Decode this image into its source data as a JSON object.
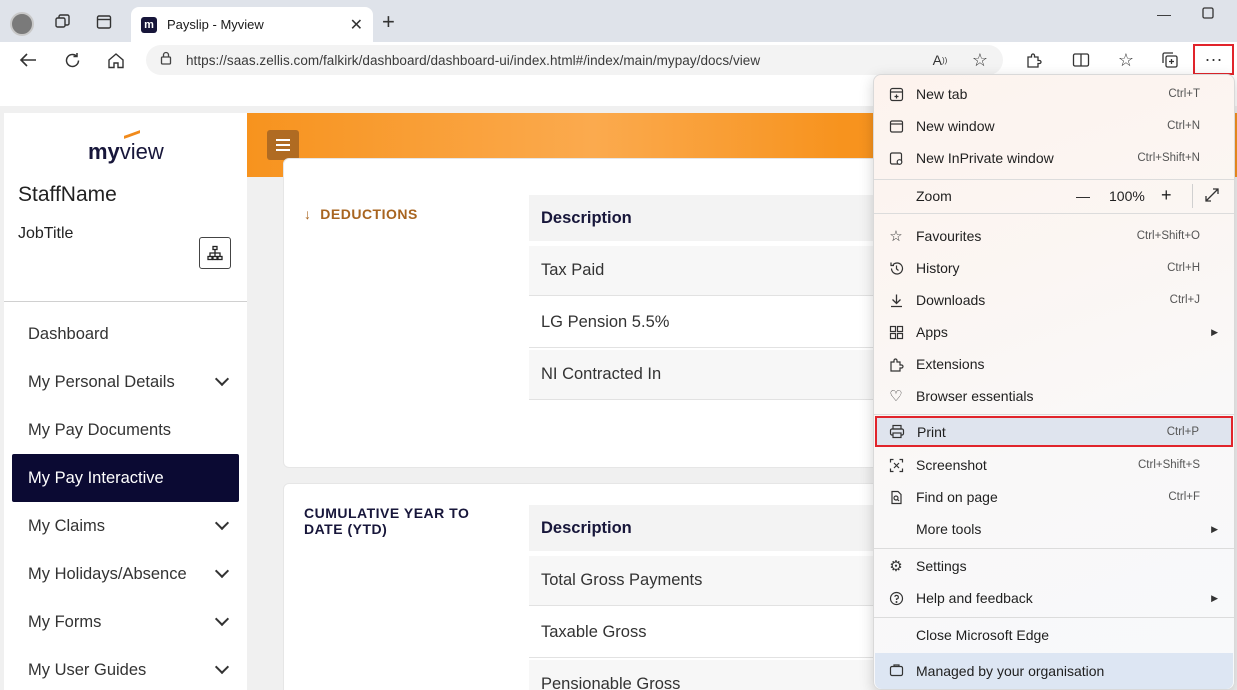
{
  "browser": {
    "tab_title": "Payslip - Myview",
    "favicon_letter": "m",
    "url": "https://saas.zellis.com/falkirk/dashboard/dashboard-ui/index.html#/index/main/mypay/docs/view"
  },
  "sidebar": {
    "logo_bold": "my",
    "logo_light": "view",
    "staff_name": "StaffName",
    "job_title": "JobTitle",
    "items": [
      {
        "label": "Dashboard",
        "expandable": false,
        "active": false
      },
      {
        "label": "My Personal Details",
        "expandable": true,
        "active": false
      },
      {
        "label": "My Pay Documents",
        "expandable": false,
        "active": false
      },
      {
        "label": "My Pay Interactive",
        "expandable": false,
        "active": true
      },
      {
        "label": "My Claims",
        "expandable": true,
        "active": false
      },
      {
        "label": "My Holidays/Absence",
        "expandable": true,
        "active": false
      },
      {
        "label": "My Forms",
        "expandable": true,
        "active": false
      },
      {
        "label": "My User Guides",
        "expandable": true,
        "active": false
      }
    ]
  },
  "deductions": {
    "title": "DEDUCTIONS",
    "header": "Description",
    "rows": [
      "Tax Paid",
      "LG Pension 5.5%",
      "NI Contracted In"
    ]
  },
  "ytd": {
    "title_line1": "CUMULATIVE YEAR TO",
    "title_line2": "DATE (YTD)",
    "header": "Description",
    "rows": [
      "Total Gross Payments",
      "Taxable Gross",
      "Pensionable Gross"
    ]
  },
  "edge_menu": {
    "new_tab": {
      "label": "New tab",
      "shortcut": "Ctrl+T"
    },
    "new_window": {
      "label": "New window",
      "shortcut": "Ctrl+N"
    },
    "inprivate": {
      "label": "New InPrivate window",
      "shortcut": "Ctrl+Shift+N"
    },
    "zoom": {
      "label": "Zoom",
      "value": "100%"
    },
    "favourites": {
      "label": "Favourites",
      "shortcut": "Ctrl+Shift+O"
    },
    "history": {
      "label": "History",
      "shortcut": "Ctrl+H"
    },
    "downloads": {
      "label": "Downloads",
      "shortcut": "Ctrl+J"
    },
    "apps": {
      "label": "Apps"
    },
    "extensions": {
      "label": "Extensions"
    },
    "browser_essentials": {
      "label": "Browser essentials"
    },
    "print": {
      "label": "Print",
      "shortcut": "Ctrl+P"
    },
    "screenshot": {
      "label": "Screenshot",
      "shortcut": "Ctrl+Shift+S"
    },
    "find": {
      "label": "Find on page",
      "shortcut": "Ctrl+F"
    },
    "more_tools": {
      "label": "More tools"
    },
    "settings": {
      "label": "Settings"
    },
    "help": {
      "label": "Help and feedback"
    },
    "close_edge": {
      "label": "Close Microsoft Edge"
    },
    "managed": {
      "label": "Managed by your organisation"
    }
  },
  "colors": {
    "highlight_border": "#e1242b",
    "brand_navy": "#0b0a33",
    "brand_orange": "#f7931e"
  }
}
